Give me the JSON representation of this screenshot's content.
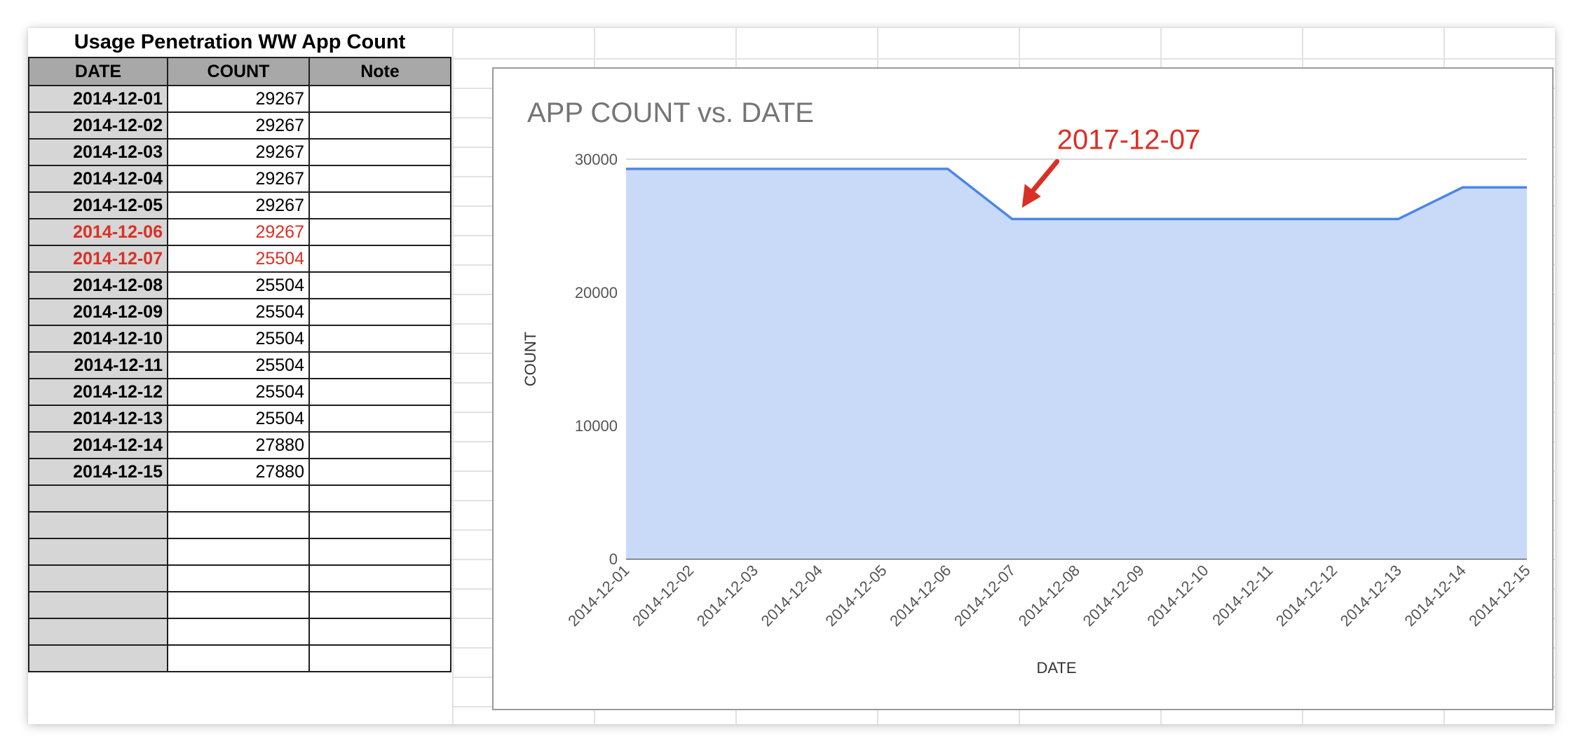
{
  "sheet": {
    "title": "Usage Penetration WW App Count",
    "headers": {
      "date": "DATE",
      "count": "COUNT",
      "note": "Note"
    },
    "rows": [
      {
        "date": "2014-12-01",
        "count": "29267",
        "note": "",
        "highlight": false
      },
      {
        "date": "2014-12-02",
        "count": "29267",
        "note": "",
        "highlight": false
      },
      {
        "date": "2014-12-03",
        "count": "29267",
        "note": "",
        "highlight": false
      },
      {
        "date": "2014-12-04",
        "count": "29267",
        "note": "",
        "highlight": false
      },
      {
        "date": "2014-12-05",
        "count": "29267",
        "note": "",
        "highlight": false
      },
      {
        "date": "2014-12-06",
        "count": "29267",
        "note": "",
        "highlight": true
      },
      {
        "date": "2014-12-07",
        "count": "25504",
        "note": "",
        "highlight": true
      },
      {
        "date": "2014-12-08",
        "count": "25504",
        "note": "",
        "highlight": false
      },
      {
        "date": "2014-12-09",
        "count": "25504",
        "note": "",
        "highlight": false
      },
      {
        "date": "2014-12-10",
        "count": "25504",
        "note": "",
        "highlight": false
      },
      {
        "date": "2014-12-11",
        "count": "25504",
        "note": "",
        "highlight": false
      },
      {
        "date": "2014-12-12",
        "count": "25504",
        "note": "",
        "highlight": false
      },
      {
        "date": "2014-12-13",
        "count": "25504",
        "note": "",
        "highlight": false
      },
      {
        "date": "2014-12-14",
        "count": "27880",
        "note": "",
        "highlight": false
      },
      {
        "date": "2014-12-15",
        "count": "27880",
        "note": "",
        "highlight": false
      },
      {
        "date": "",
        "count": "",
        "note": "",
        "highlight": false
      },
      {
        "date": "",
        "count": "",
        "note": "",
        "highlight": false
      },
      {
        "date": "",
        "count": "",
        "note": "",
        "highlight": false
      },
      {
        "date": "",
        "count": "",
        "note": "",
        "highlight": false
      },
      {
        "date": "",
        "count": "",
        "note": "",
        "highlight": false
      },
      {
        "date": "",
        "count": "",
        "note": "",
        "highlight": false
      },
      {
        "date": "",
        "count": "",
        "note": "",
        "highlight": false
      }
    ]
  },
  "colors": {
    "highlight_text": "#d93025",
    "header_bg": "#a8a8a8",
    "date_col_bg": "#d6d6d6",
    "series_line": "#4a86e8",
    "series_fill": "#c9daf8",
    "annotation": "#d93025"
  },
  "chart_data": {
    "type": "area",
    "title": "APP COUNT vs. DATE",
    "xlabel": "DATE",
    "ylabel": "COUNT",
    "ylim": [
      0,
      30000
    ],
    "yticks": [
      0,
      10000,
      20000,
      30000
    ],
    "grid": true,
    "x": [
      "2014-12-01",
      "2014-12-02",
      "2014-12-03",
      "2014-12-04",
      "2014-12-05",
      "2014-12-06",
      "2014-12-07",
      "2014-12-08",
      "2014-12-09",
      "2014-12-10",
      "2014-12-11",
      "2014-12-12",
      "2014-12-13",
      "2014-12-14",
      "2014-12-15"
    ],
    "series": [
      {
        "values": [
          29267,
          29267,
          29267,
          29267,
          29267,
          29267,
          25504,
          25504,
          25504,
          25504,
          25504,
          25504,
          25504,
          27880,
          27880
        ]
      }
    ],
    "annotation": {
      "text": "2017-12-07",
      "x": "2014-12-07"
    }
  }
}
